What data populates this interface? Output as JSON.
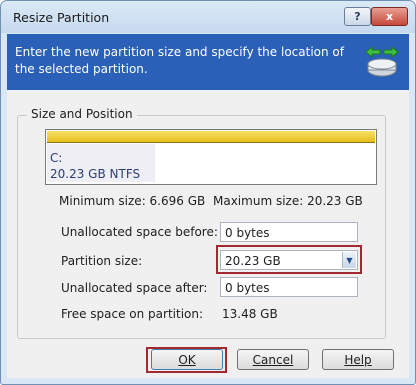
{
  "window": {
    "title": "Resize Partition"
  },
  "titlebar": {
    "help_label": "?",
    "close_label": "x"
  },
  "banner": {
    "text": "Enter the new partition size and specify the location of the selected partition."
  },
  "group": {
    "label": "Size and Position"
  },
  "partition": {
    "drive": "C:",
    "info": "20.23 GB  NTFS"
  },
  "sizes": {
    "min_label": "Minimum size: 6.696 GB",
    "max_label": "Maximum size: 20.23 GB"
  },
  "fields": {
    "before_label": "Unallocated space before:",
    "before_value": "0 bytes",
    "size_label": "Partition size:",
    "size_value": "20.23 GB",
    "after_label": "Unallocated space after:",
    "after_value": "0 bytes",
    "free_label": "Free space on partition:",
    "free_value": "13.48 GB"
  },
  "buttons": {
    "ok": "OK",
    "cancel": "Cancel",
    "help": "Help"
  },
  "colors": {
    "banner": "#2a60b8",
    "highlight": "#a2292f",
    "partition_bar": "#e7bd1a"
  }
}
